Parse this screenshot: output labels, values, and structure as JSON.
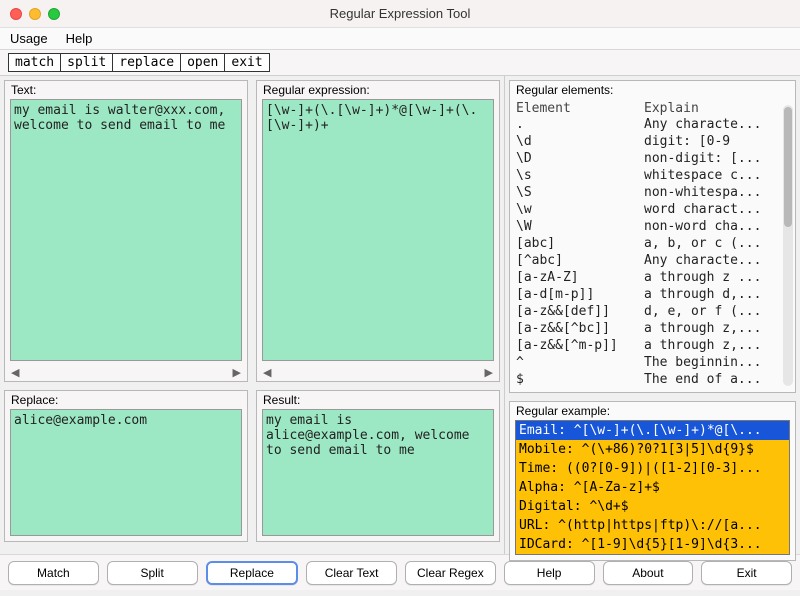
{
  "window": {
    "title": "Regular Expression Tool"
  },
  "menubar": {
    "usage": "Usage",
    "help": "Help"
  },
  "toolbar": {
    "match": "match",
    "split": "split",
    "replace": "replace",
    "open": "open",
    "exit": "exit"
  },
  "labels": {
    "text": "Text:",
    "regex": "Regular expression:",
    "replace": "Replace:",
    "result": "Result:",
    "elements": "Regular elements:",
    "element_col": "Element",
    "explain_col": "Explain",
    "example": "Regular example:"
  },
  "fields": {
    "text": "my email is walter@xxx.com, welcome to send email to me",
    "regex": "[\\w-]+(\\.[\\w-]+)*@[\\w-]+(\\.[\\w-]+)+",
    "replace": "alice@example.com",
    "result": "my email is alice@example.com, welcome to send email to me"
  },
  "elements": [
    {
      "el": ".",
      "ex": "Any characte..."
    },
    {
      "el": "\\d",
      "ex": "digit: [0-9"
    },
    {
      "el": "\\D",
      "ex": "non-digit: [..."
    },
    {
      "el": "\\s",
      "ex": "whitespace c..."
    },
    {
      "el": "\\S",
      "ex": "non-whitespa..."
    },
    {
      "el": "\\w",
      "ex": "word charact..."
    },
    {
      "el": "\\W",
      "ex": "non-word cha..."
    },
    {
      "el": "[abc]",
      "ex": "a, b, or c (..."
    },
    {
      "el": "[^abc]",
      "ex": "Any characte..."
    },
    {
      "el": "[a-zA-Z]",
      "ex": "a through z ..."
    },
    {
      "el": "[a-d[m-p]]",
      "ex": "a through d,..."
    },
    {
      "el": "[a-z&&[def]]",
      "ex": "d, e, or f (..."
    },
    {
      "el": "[a-z&&[^bc]]",
      "ex": "a through z,..."
    },
    {
      "el": "[a-z&&[^m-p]]",
      "ex": "a through z,..."
    },
    {
      "el": "^",
      "ex": "The beginnin..."
    },
    {
      "el": "$",
      "ex": "The end of a..."
    }
  ],
  "examples": [
    {
      "t": "Email: ^[\\w-]+(\\.[\\w-]+)*@[\\...",
      "sel": true
    },
    {
      "t": "Mobile: ^(\\+86)?0?1[3|5]\\d{9}$",
      "sel": false
    },
    {
      "t": "Time: ((0?[0-9])|([1-2][0-3]...",
      "sel": false
    },
    {
      "t": "Alpha: ^[A-Za-z]+$",
      "sel": false
    },
    {
      "t": "Digital: ^\\d+$",
      "sel": false
    },
    {
      "t": "URL: ^(http|https|ftp)\\://[a...",
      "sel": false
    },
    {
      "t": "IDCard: ^[1-9]\\d{5}[1-9]\\d{3...",
      "sel": false
    }
  ],
  "buttons": {
    "match": "Match",
    "split": "Split",
    "replace": "Replace",
    "cleartext": "Clear Text",
    "clearregex": "Clear Regex",
    "help": "Help",
    "about": "About",
    "exit": "Exit"
  }
}
